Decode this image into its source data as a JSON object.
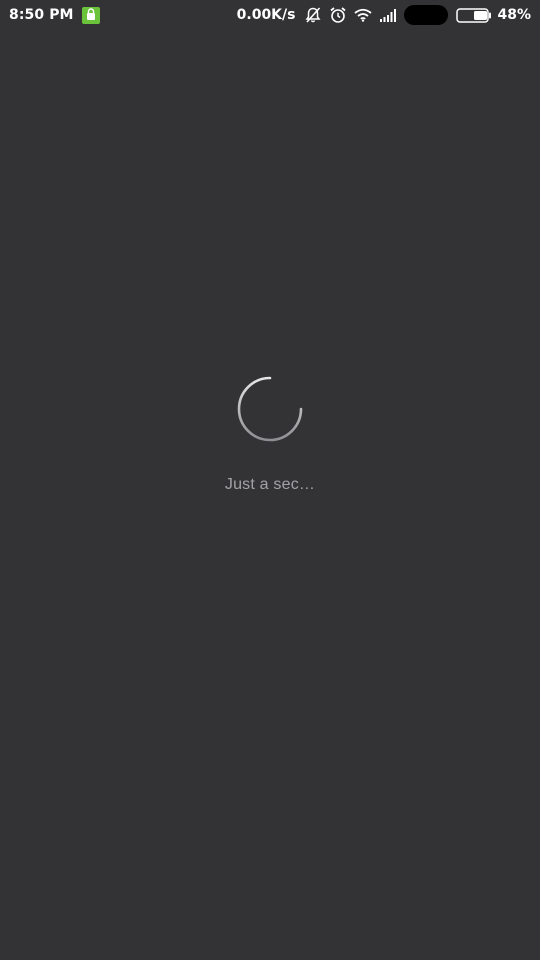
{
  "status_bar": {
    "time": "8:50 PM",
    "network_speed": "0.00K/s",
    "battery_percent": "48%",
    "battery_level": 0.48,
    "icons": [
      "app-notification-icon",
      "notifications-muted-icon",
      "alarm-icon",
      "wifi-icon",
      "cell-signal-icon",
      "battery-icon"
    ],
    "app_icon_color": "#6ac33b"
  },
  "loading": {
    "message": "Just a sec…",
    "spinner_color": "#e6e6e6"
  },
  "background_color": "#333235"
}
